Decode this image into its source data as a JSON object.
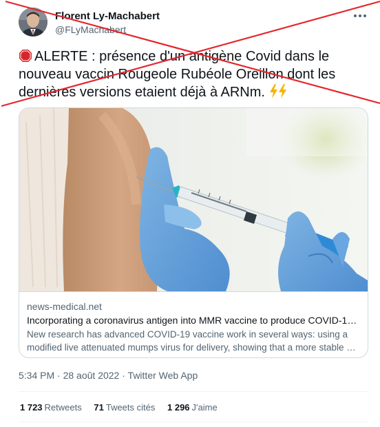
{
  "author": {
    "name": "Florent Ly-Machabert",
    "handle": "@FLyMachabert"
  },
  "tweet": {
    "text": "ALERTE : présence d'un antigène Covid dans le nouveau vaccin Rougeole Rubéole Oreillon dont les dernières versions etaient déjà à ARNm.",
    "prefix_icon": "stop-sign-icon",
    "suffix_icons": [
      "high-voltage-icon",
      "high-voltage-icon"
    ]
  },
  "card": {
    "domain": "news-medical.net",
    "title": "Incorporating a coronavirus antigen into MMR vaccine to produce COVID-19 im…",
    "description": "New research has advanced COVID-19 vaccine work in several ways: using a modified live attenuated mumps virus for delivery, showing that a more stable …"
  },
  "meta": {
    "time": "5:34 PM",
    "date": "28 août 2022",
    "source": "Twitter Web App",
    "separator": "·"
  },
  "stats": {
    "retweets_count": "1 723",
    "retweets_label": "Retweets",
    "quotes_count": "71",
    "quotes_label": "Tweets cités",
    "likes_count": "1 296",
    "likes_label": "J'aime"
  },
  "colors": {
    "text": "#0f1419",
    "secondary": "#536471",
    "border": "#cfd9de",
    "overlay_cross": "#e4262c"
  }
}
